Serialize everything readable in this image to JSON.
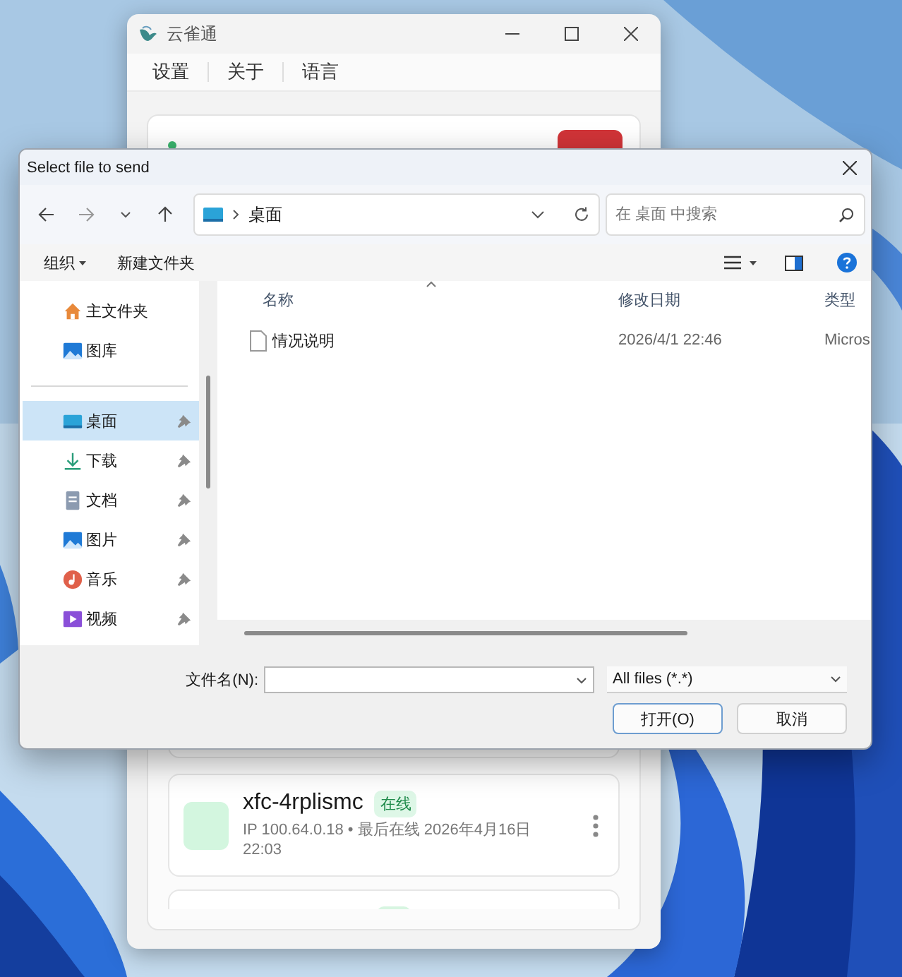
{
  "app_window": {
    "title": "云雀通",
    "menu": [
      "设置",
      "关于",
      "语言"
    ],
    "devices": [
      {
        "name": "xfc-4rplismc",
        "status": "在线",
        "details": "IP 100.64.0.18 • 最后在线 2026年4月16日 22:03"
      }
    ]
  },
  "dialog": {
    "title": "Select file to send",
    "location": "桌面",
    "search": {
      "placeholder": "在 桌面 中搜索"
    },
    "toolbar": [
      {
        "label": "组织",
        "has_menu": true
      },
      {
        "label": "新建文件夹",
        "has_menu": false
      }
    ],
    "sidebar": {
      "places": [
        {
          "label": "主文件夹",
          "kind": "home",
          "pinned": false,
          "selected": false
        },
        {
          "label": "图库",
          "kind": "gallery",
          "pinned": false,
          "selected": false
        }
      ],
      "quick_access": [
        {
          "label": "桌面",
          "kind": "desktop",
          "pinned": true,
          "selected": true
        },
        {
          "label": "下载",
          "kind": "download",
          "pinned": true,
          "selected": false
        },
        {
          "label": "文档",
          "kind": "documents",
          "pinned": true,
          "selected": false
        },
        {
          "label": "图片",
          "kind": "pictures",
          "pinned": true,
          "selected": false
        },
        {
          "label": "音乐",
          "kind": "music",
          "pinned": true,
          "selected": false
        },
        {
          "label": "视频",
          "kind": "videos",
          "pinned": true,
          "selected": false
        }
      ]
    },
    "columns": [
      "名称",
      "修改日期",
      "类型"
    ],
    "files": [
      {
        "name": "情况说明",
        "modified": "2026/4/1 22:46",
        "type": "Micros"
      }
    ],
    "filename": {
      "label": "文件名(N):"
    },
    "filter": "All files (*.*)",
    "buttons": [
      {
        "label": "打开(O)",
        "default": true
      },
      {
        "label": "取消",
        "default": false
      }
    ]
  }
}
